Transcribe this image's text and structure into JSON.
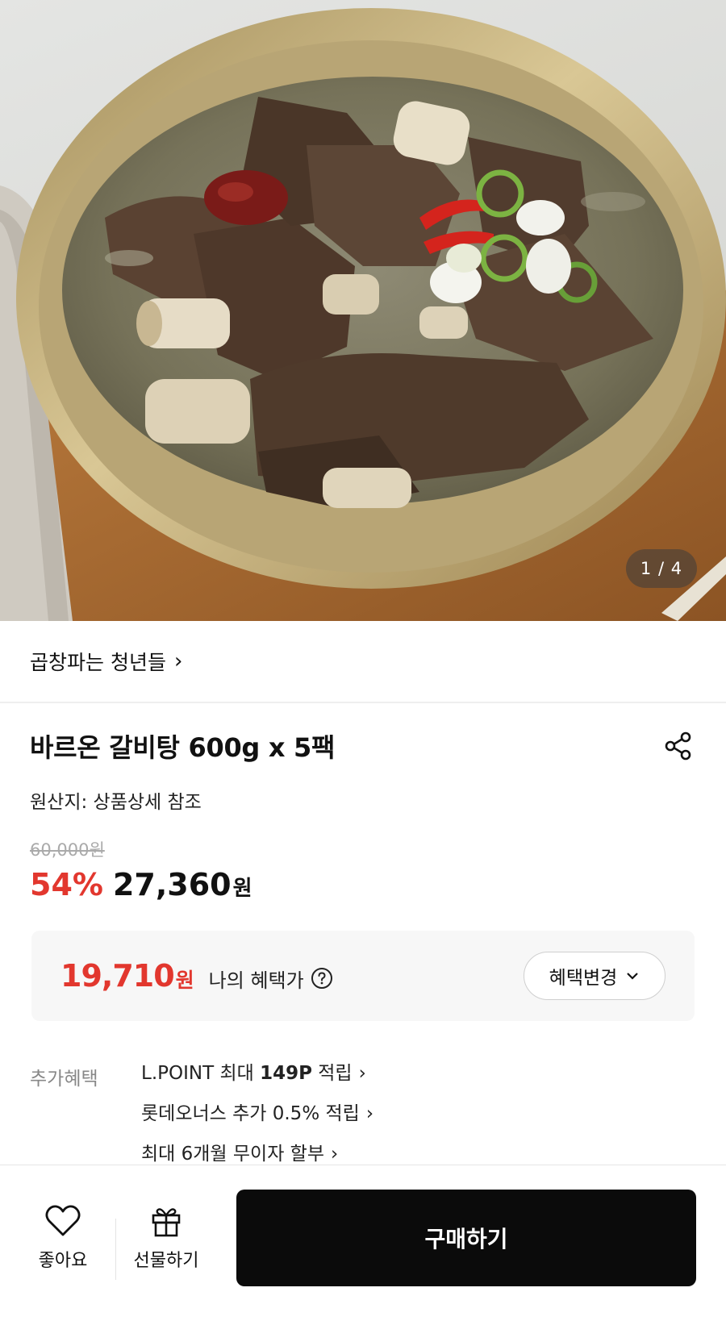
{
  "hero": {
    "page_indicator": "1 / 4"
  },
  "brand": {
    "name": "곱창파는 청년들",
    "chevron": "›"
  },
  "product": {
    "title": "바르온 갈비탕 600g x 5팩",
    "origin": "원산지: 상품상세 참조",
    "original_price": "60,000원",
    "discount_rate": "54%",
    "price": "27,360",
    "price_unit": "원"
  },
  "benefit": {
    "price": "19,710",
    "price_unit": "원",
    "label": "나의 혜택가",
    "change_button": "혜택변경"
  },
  "extra_benefits": {
    "label": "추가혜택",
    "items": [
      {
        "pre": "L.POINT 최대 ",
        "bold": "149P",
        "post": " 적립"
      },
      {
        "pre": "롯데오너스 추가 0.5% 적립",
        "bold": "",
        "post": ""
      },
      {
        "pre": "최대 6개월 무이자 할부",
        "bold": "",
        "post": ""
      }
    ],
    "chevron": "›"
  },
  "bottom_bar": {
    "like_label": "좋아요",
    "gift_label": "선물하기",
    "buy_label": "구매하기"
  },
  "colors": {
    "accent_red": "#e2372e",
    "buy_button": "#0b0b0b"
  },
  "icons": {
    "share": "share-icon",
    "help": "question-circle-icon",
    "like": "heart-icon",
    "gift": "gift-icon",
    "dropdown": "chevron-down-icon"
  }
}
